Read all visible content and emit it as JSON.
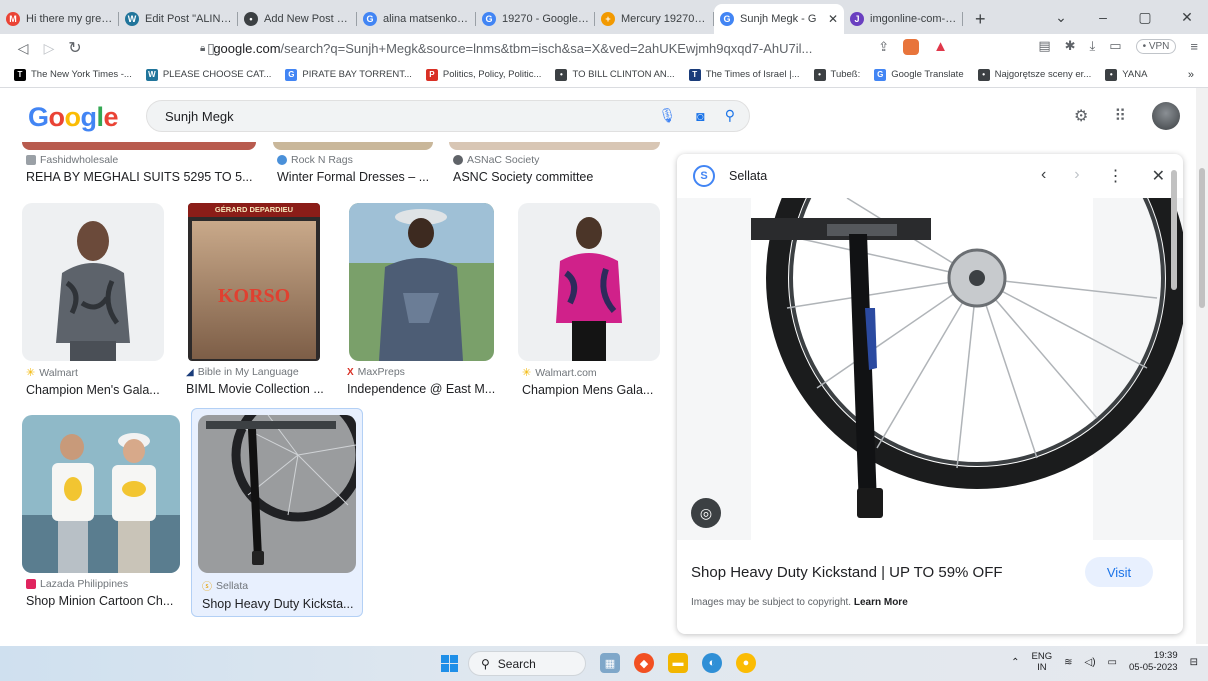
{
  "browser": {
    "tabs": [
      {
        "title": "Hi there my great pe",
        "color": "#ea4335",
        "glyph": "M"
      },
      {
        "title": "Edit Post \"ALINKA – ",
        "color": "#21759b",
        "glyph": "W"
      },
      {
        "title": "Add New Post ‹ ALIN",
        "color": "#3c4043",
        "glyph": "•"
      },
      {
        "title": "alina matsenko indu",
        "color": "#4285f4",
        "glyph": "G"
      },
      {
        "title": "19270 - Google Sea",
        "color": "#4285f4",
        "glyph": "G"
      },
      {
        "title": "Mercury 19270 - TH",
        "color": "#f29900",
        "glyph": "+"
      },
      {
        "title": "Sunjh Megk - G",
        "color": "#4285f4",
        "glyph": "G",
        "active": true
      },
      {
        "title": "imgonline-com-ua-",
        "color": "#6a3fc0",
        "glyph": "J"
      }
    ],
    "new_tab": "+",
    "window_controls": [
      "⌄",
      "–",
      "▢",
      "✕"
    ],
    "url_host": "google.com",
    "url_rest": "/search?q=Sunjh+Megk&source=lnms&tbm=isch&sa=X&ved=2ahUKEwjmh9qxqd7-AhU7il...",
    "vpn": "• VPN",
    "bookmarks": [
      {
        "label": "The New York Times -...",
        "color": "#000000",
        "glyph": "T"
      },
      {
        "label": "PLEASE CHOOSE CAT...",
        "color": "#21759b",
        "glyph": "W"
      },
      {
        "label": "PIRATE BAY TORRENT...",
        "color": "#4285f4",
        "glyph": "G"
      },
      {
        "label": "Politics, Policy, Politic...",
        "color": "#d93025",
        "glyph": "P"
      },
      {
        "label": "TO BILL CLINTON AN...",
        "color": "#3c4043",
        "glyph": "•"
      },
      {
        "label": "The Times of Israel |...",
        "color": "#1a3c7a",
        "glyph": "T"
      },
      {
        "label": "Tubeß:",
        "color": "#3c4043",
        "glyph": "•"
      },
      {
        "label": "Google Translate",
        "color": "#4285f4",
        "glyph": "G"
      },
      {
        "label": "Najgorętsze sceny er...",
        "color": "#3c4043",
        "glyph": "•"
      },
      {
        "label": "YANA",
        "color": "#3c4043",
        "glyph": "•"
      }
    ],
    "bookmarks_more": "»"
  },
  "google": {
    "logo": "Google",
    "query": "Sunjh Megk"
  },
  "results": {
    "row0": [
      {
        "source": "Fashidwholesale",
        "title": "REHA BY MEGHALI SUITS 5295 TO 5..."
      },
      {
        "source": "Rock N Rags",
        "title": "Winter Formal Dresses – ..."
      },
      {
        "source": "ASNaC Society",
        "title": "ASNC Society committee"
      }
    ],
    "row1": [
      {
        "source": "Walmart",
        "title": "Champion Men's Gala..."
      },
      {
        "source": "Bible in My Language",
        "title": "BIML Movie Collection ..."
      },
      {
        "source": "MaxPreps",
        "title": "Independence @ East M..."
      },
      {
        "source": "Walmart.com",
        "title": "Champion Mens Gala..."
      }
    ],
    "row2": [
      {
        "source": "Lazada Philippines",
        "title": "Shop Minion Cartoon Ch..."
      },
      {
        "source": "Sellata",
        "title": "Shop Heavy Duty Kicksta..."
      }
    ],
    "poster_top": "GÉRARD DEPARDIEU",
    "poster_title": "KORSO"
  },
  "panel": {
    "source": "Sellata",
    "title": "Shop Heavy Duty Kickstand | UP TO 59% OFF",
    "visit": "Visit",
    "copyright": "Images may be subject to copyright.",
    "learn_more": "Learn More"
  },
  "taskbar": {
    "search": "Search",
    "lang_top": "ENG",
    "lang_bottom": "IN",
    "time": "19:39",
    "date": "05-05-2023"
  }
}
